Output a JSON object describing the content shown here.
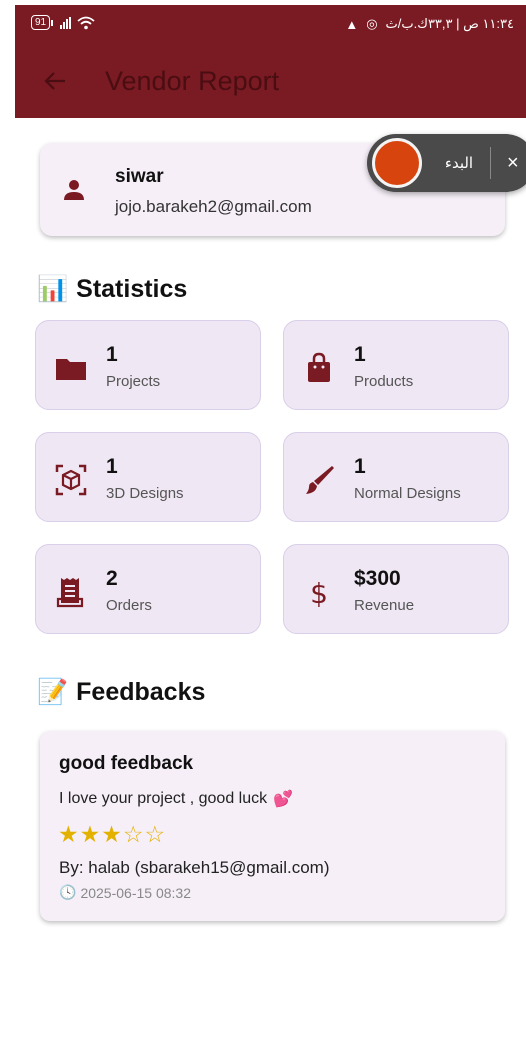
{
  "status_bar": {
    "battery": "91",
    "time_text": "١١:٣٤ ص | ٣٣,٣ك.ب/ث"
  },
  "app_bar": {
    "title": "Vendor Report",
    "color": "#7a1a22"
  },
  "profile": {
    "name": "siwar",
    "email": "jojo.barakeh2@gmail.com",
    "icon": "person-icon"
  },
  "floating_widget": {
    "label": "البدء",
    "close_glyph": "×"
  },
  "statistics": {
    "title": "Statistics",
    "emoji": "📊",
    "cards": [
      {
        "value": "1",
        "label": "Projects",
        "icon": "folder-icon"
      },
      {
        "value": "1",
        "label": "Products",
        "icon": "shopping-bag-icon"
      },
      {
        "value": "1",
        "label": "3D Designs",
        "icon": "cube-scan-icon"
      },
      {
        "value": "1",
        "label": "Normal Designs",
        "icon": "brush-icon"
      },
      {
        "value": "2",
        "label": "Orders",
        "icon": "receipt-icon"
      },
      {
        "value": "$300",
        "label": "Revenue",
        "icon": "dollar-icon"
      }
    ]
  },
  "feedbacks": {
    "title": "Feedbacks",
    "emoji": "📝",
    "items": [
      {
        "title": "good feedback",
        "text": "I love your project , good luck",
        "emoji": "💕",
        "rating": 3,
        "stars_text": "★★★☆☆",
        "by": "By: halab (sbarakeh15@gmail.com)",
        "date": "2025-06-15 08:32",
        "clock": "🕓"
      }
    ]
  },
  "accent_color": "#7a1a22"
}
